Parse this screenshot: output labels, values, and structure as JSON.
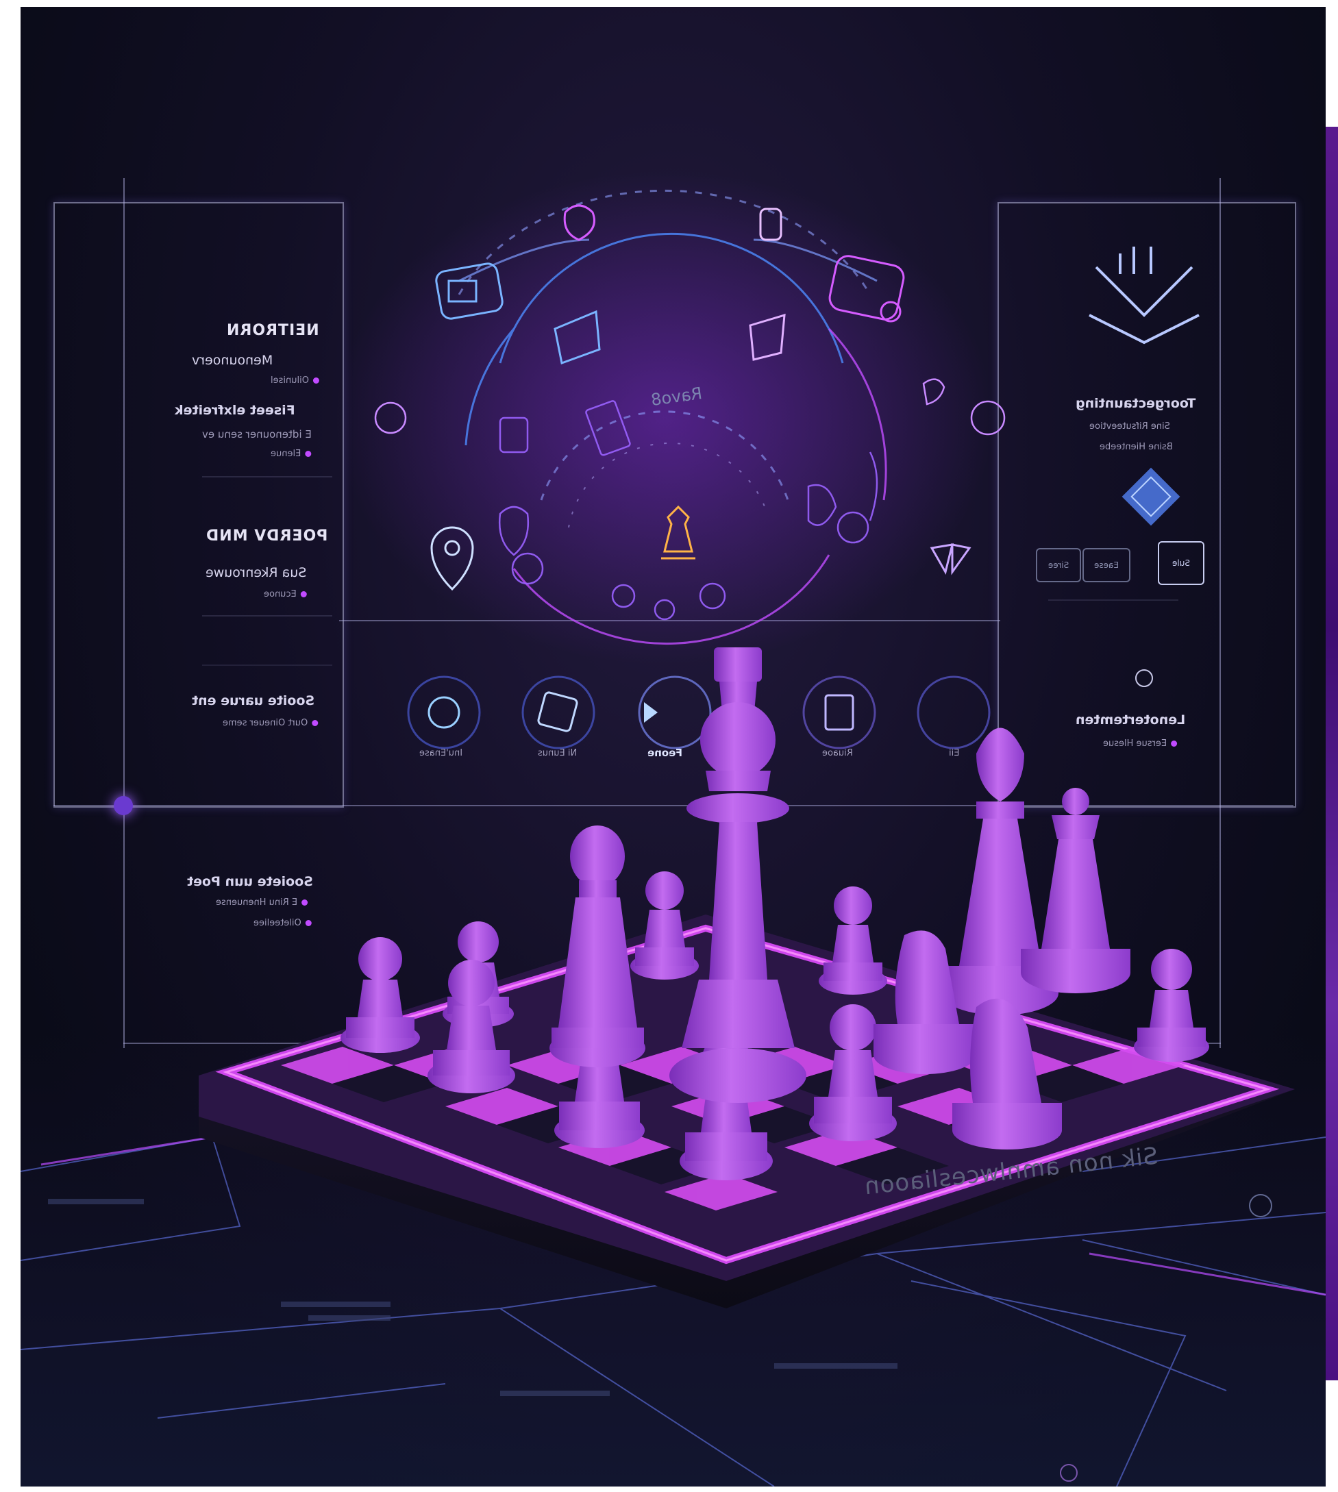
{
  "left_panel": {
    "section1_title": "NEITRORN",
    "section1_sub": "Menounoerv",
    "section1_small": "Oilunisel",
    "section2_title": "Fiseet elxfreitek",
    "section2_sub": "E idtenouner senu ev",
    "section2_small": "Elenue",
    "section3_title": "POERDV MND",
    "section3_sub": "Sua Rkenrouwe",
    "section3_small": "Ecunoe",
    "section4_title": "Sooite uarue ent",
    "section4_small": "Ourt Oineuer seme",
    "section5_title": "Sooiete uun Poet",
    "section5_sub": "E Rinu Hnenuense",
    "section5_small": "Oileteeliee"
  },
  "right_panel": {
    "title": "Toorgectaunting",
    "sub1": "Sine Rifsuteevtioe",
    "sub2": "Bsine Hienteebe",
    "btn1": "Siree",
    "btn2": "Eaese",
    "btn3": "Sule",
    "footer_title": "Lenotertemten",
    "footer_small": "Eersue Hlesue"
  },
  "center_panel": {
    "arc_label": "Ravo8",
    "icon_labels": [
      "Inu'Enase",
      "Ni Eunus",
      "Feone",
      "Riuaoe",
      "Eii"
    ]
  },
  "board_text": "Sik non amnlwcesliaoon",
  "colors": {
    "accent_purple": "#c14bff",
    "neon_pink": "#e04dff",
    "neon_blue": "#5aa8ff",
    "piece": "#b25ee8"
  }
}
